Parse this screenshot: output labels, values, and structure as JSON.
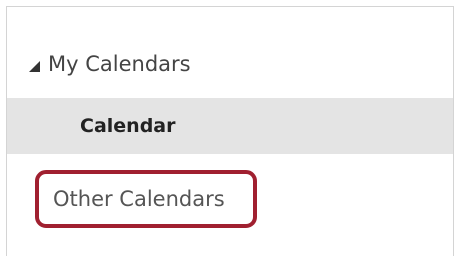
{
  "sidebar": {
    "group_label": "My Calendars",
    "calendar_item_label": "Calendar",
    "other_calendars_label": "Other Calendars"
  },
  "colors": {
    "selected_background": "#e4e4e4",
    "highlight_border": "#a02030",
    "panel_border": "#d4d4d4"
  },
  "icons": {
    "group_toggle": "expanded-triangle-icon"
  }
}
